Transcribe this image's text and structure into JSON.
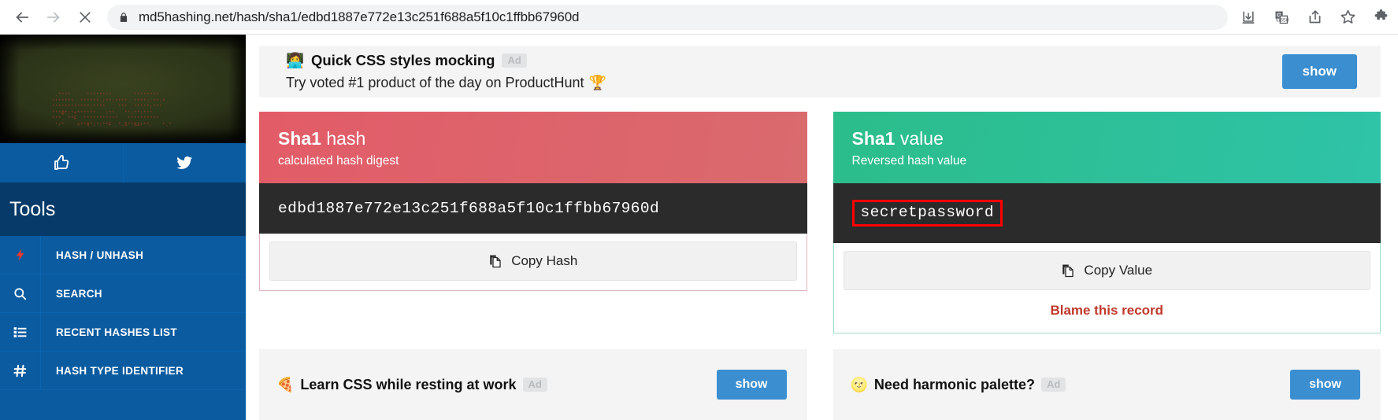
{
  "browser": {
    "back_icon": "arrow-left-icon",
    "forward_icon": "arrow-right-icon",
    "stop_icon": "close-x-icon",
    "lock_icon": "lock-icon",
    "url": "md5hashing.net/hash/sha1/edbd1887e772e13c251f688a5f10c1ffbb67960d",
    "toolbar_icons": [
      "download-icon",
      "translate-icon",
      "share-icon",
      "bookmark-star-icon",
      "extensions-puzzle-icon"
    ]
  },
  "sidebar": {
    "banner": {
      "name": "crt-terminal-banner",
      "ascii": "  .****     ********       ********\n *******  ******.:**:****  ****::**:*\n ************:****    ***  *****:***\n ***@*:*<******   :**   **:**:***\n ***  **F  ***********   **********\n  */*    <**6*:*:**F  *.5**%3+**.   *.*"
    },
    "social": [
      {
        "name": "facebook-like-button",
        "icon": "thumbs-up-icon"
      },
      {
        "name": "twitter-share-button",
        "icon": "twitter-bird-icon"
      }
    ],
    "tools_header": "Tools",
    "items": [
      {
        "label": "HASH / UNHASH",
        "icon": "lightning-bolt-icon",
        "name": "sidebar-item-hash-unhash"
      },
      {
        "label": "SEARCH",
        "icon": "search-icon",
        "name": "sidebar-item-search"
      },
      {
        "label": "RECENT HASHES LIST",
        "icon": "list-icon",
        "name": "sidebar-item-recent-hashes"
      },
      {
        "label": "HASH TYPE IDENTIFIER",
        "icon": "hash-icon",
        "name": "sidebar-item-hash-type-identifier"
      }
    ]
  },
  "ad_banner": {
    "emoji": "👩‍💻",
    "title": "Quick CSS styles mocking",
    "badge": "Ad",
    "subtitle": "Try voted #1 product of the day on ProductHunt",
    "subtitle_emoji": "🏆",
    "cta": "show"
  },
  "hash_card": {
    "title_strong": "Sha1",
    "title_rest": " hash",
    "subtitle": "calculated hash digest",
    "value": "edbd1887e772e13c251f688a5f10c1ffbb67960d",
    "copy_label": "Copy Hash",
    "copy_icon": "copy-icon",
    "accent_color": "#e25c68"
  },
  "value_card": {
    "title_strong": "Sha1",
    "title_rest": " value",
    "subtitle": "Reversed hash value",
    "value": "secretpassword",
    "copy_label": "Copy Value",
    "copy_icon": "copy-icon",
    "blame_label": "Blame this record",
    "accent_color": "#2bbd8a",
    "highlight_color": "#ff0000"
  },
  "bottom_ads": [
    {
      "emoji": "🍕",
      "title": "Learn CSS while resting at work",
      "badge": "Ad",
      "cta": "show"
    },
    {
      "emoji": "🌝",
      "title": "Need harmonic palette?",
      "badge": "Ad",
      "cta": "show"
    }
  ]
}
